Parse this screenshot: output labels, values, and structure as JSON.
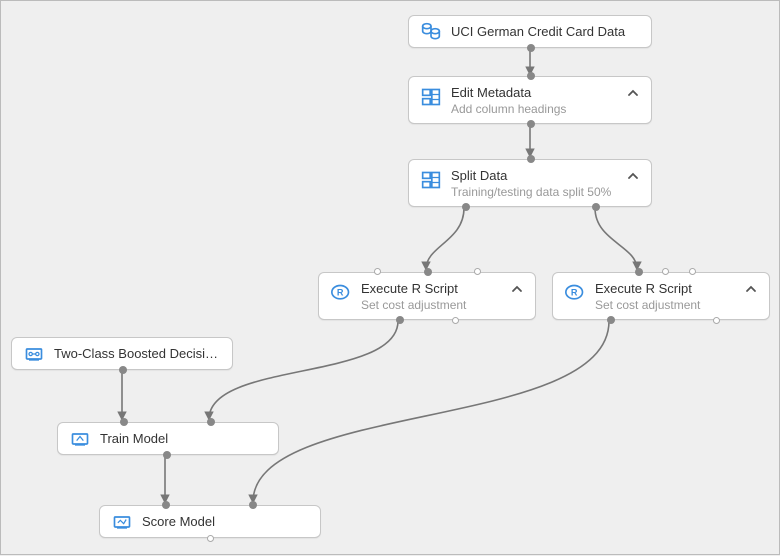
{
  "diagram": {
    "type": "ml-pipeline",
    "tool_style": "Azure ML Studio"
  },
  "nodes": {
    "data_source": {
      "title": "UCI German Credit Card Data"
    },
    "edit_metadata": {
      "title": "Edit Metadata",
      "subtitle": "Add column headings"
    },
    "split_data": {
      "title": "Split Data",
      "subtitle": "Training/testing data split 50%"
    },
    "r_script_left": {
      "title": "Execute R Script",
      "subtitle": "Set cost adjustment"
    },
    "r_script_right": {
      "title": "Execute R Script",
      "subtitle": "Set cost adjustment"
    },
    "algorithm": {
      "title": "Two-Class Boosted Decision..."
    },
    "train_model": {
      "title": "Train Model"
    },
    "score_model": {
      "title": "Score Model"
    }
  },
  "edges": [
    {
      "from": "data_source",
      "to": "edit_metadata"
    },
    {
      "from": "edit_metadata",
      "to": "split_data"
    },
    {
      "from": "split_data",
      "to": "r_script_left"
    },
    {
      "from": "split_data",
      "to": "r_script_right"
    },
    {
      "from": "algorithm",
      "to": "train_model"
    },
    {
      "from": "r_script_left",
      "to": "train_model"
    },
    {
      "from": "train_model",
      "to": "score_model"
    },
    {
      "from": "r_script_right",
      "to": "score_model"
    }
  ]
}
